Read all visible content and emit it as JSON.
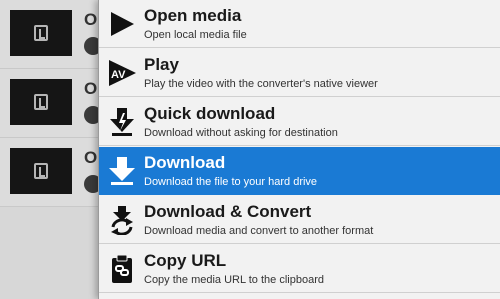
{
  "colors": {
    "menu_background": "#f2f2f2",
    "active_background": "#1a7ad4",
    "text": "#1a1a1a",
    "active_text": "#ffffff"
  },
  "background_list": {
    "rows": [
      {
        "title_fragment": "O"
      },
      {
        "title_fragment": "O"
      },
      {
        "title_fragment": "O"
      }
    ]
  },
  "menu": {
    "items": [
      {
        "title": "Open media",
        "description": "Open local media file",
        "icon": "play-triangle-icon",
        "active": false
      },
      {
        "title": "Play",
        "description": "Play the video with the converter's native viewer",
        "icon": "av-player-icon",
        "active": false
      },
      {
        "title": "Quick download",
        "description": "Download without asking for destination",
        "icon": "quick-download-icon",
        "active": false
      },
      {
        "title": "Download",
        "description": "Download the file to your hard drive",
        "icon": "download-arrow-icon",
        "active": true
      },
      {
        "title": "Download & Convert",
        "description": "Download media and convert to another format",
        "icon": "download-convert-icon",
        "active": false
      },
      {
        "title": "Copy URL",
        "description": "Copy the media URL to the clipboard",
        "icon": "clipboard-link-icon",
        "active": false
      }
    ]
  }
}
